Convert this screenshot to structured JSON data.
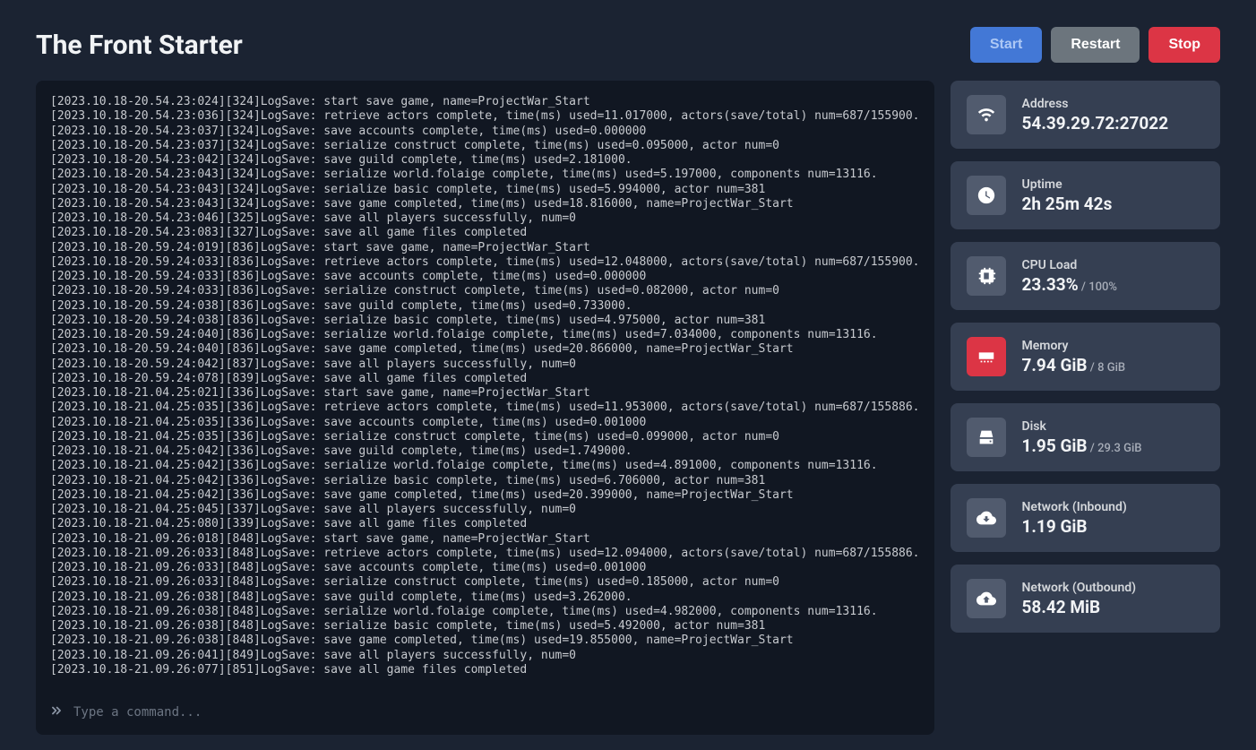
{
  "title": "The Front Starter",
  "buttons": {
    "start": "Start",
    "restart": "Restart",
    "stop": "Stop"
  },
  "console": {
    "placeholder": "Type a command...",
    "lines": [
      "[2023.10.18-20.54.23:024][324]LogSave: start save game, name=ProjectWar_Start",
      "[2023.10.18-20.54.23:036][324]LogSave: retrieve actors complete, time(ms) used=11.017000, actors(save/total) num=687/155900.",
      "[2023.10.18-20.54.23:037][324]LogSave: save accounts complete, time(ms) used=0.000000",
      "[2023.10.18-20.54.23:037][324]LogSave: serialize construct complete, time(ms) used=0.095000, actor num=0",
      "[2023.10.18-20.54.23:042][324]LogSave: save guild complete, time(ms) used=2.181000.",
      "[2023.10.18-20.54.23:043][324]LogSave: serialize world.folaige complete, time(ms) used=5.197000, components num=13116.",
      "[2023.10.18-20.54.23:043][324]LogSave: serialize basic complete, time(ms) used=5.994000, actor num=381",
      "[2023.10.18-20.54.23:043][324]LogSave: save game completed, time(ms) used=18.816000, name=ProjectWar_Start",
      "[2023.10.18-20.54.23:046][325]LogSave: save all players successfully, num=0",
      "[2023.10.18-20.54.23:083][327]LogSave: save all game files completed",
      "[2023.10.18-20.59.24:019][836]LogSave: start save game, name=ProjectWar_Start",
      "[2023.10.18-20.59.24:033][836]LogSave: retrieve actors complete, time(ms) used=12.048000, actors(save/total) num=687/155900.",
      "[2023.10.18-20.59.24:033][836]LogSave: save accounts complete, time(ms) used=0.000000",
      "[2023.10.18-20.59.24:033][836]LogSave: serialize construct complete, time(ms) used=0.082000, actor num=0",
      "[2023.10.18-20.59.24:038][836]LogSave: save guild complete, time(ms) used=0.733000.",
      "[2023.10.18-20.59.24:038][836]LogSave: serialize basic complete, time(ms) used=4.975000, actor num=381",
      "[2023.10.18-20.59.24:040][836]LogSave: serialize world.folaige complete, time(ms) used=7.034000, components num=13116.",
      "[2023.10.18-20.59.24:040][836]LogSave: save game completed, time(ms) used=20.866000, name=ProjectWar_Start",
      "[2023.10.18-20.59.24:042][837]LogSave: save all players successfully, num=0",
      "[2023.10.18-20.59.24:078][839]LogSave: save all game files completed",
      "[2023.10.18-21.04.25:021][336]LogSave: start save game, name=ProjectWar_Start",
      "[2023.10.18-21.04.25:035][336]LogSave: retrieve actors complete, time(ms) used=11.953000, actors(save/total) num=687/155886.",
      "[2023.10.18-21.04.25:035][336]LogSave: save accounts complete, time(ms) used=0.001000",
      "[2023.10.18-21.04.25:035][336]LogSave: serialize construct complete, time(ms) used=0.099000, actor num=0",
      "[2023.10.18-21.04.25:042][336]LogSave: save guild complete, time(ms) used=1.749000.",
      "[2023.10.18-21.04.25:042][336]LogSave: serialize world.folaige complete, time(ms) used=4.891000, components num=13116.",
      "[2023.10.18-21.04.25:042][336]LogSave: serialize basic complete, time(ms) used=6.706000, actor num=381",
      "[2023.10.18-21.04.25:042][336]LogSave: save game completed, time(ms) used=20.399000, name=ProjectWar_Start",
      "[2023.10.18-21.04.25:045][337]LogSave: save all players successfully, num=0",
      "[2023.10.18-21.04.25:080][339]LogSave: save all game files completed",
      "[2023.10.18-21.09.26:018][848]LogSave: start save game, name=ProjectWar_Start",
      "[2023.10.18-21.09.26:033][848]LogSave: retrieve actors complete, time(ms) used=12.094000, actors(save/total) num=687/155886.",
      "[2023.10.18-21.09.26:033][848]LogSave: save accounts complete, time(ms) used=0.001000",
      "[2023.10.18-21.09.26:033][848]LogSave: serialize construct complete, time(ms) used=0.185000, actor num=0",
      "[2023.10.18-21.09.26:038][848]LogSave: save guild complete, time(ms) used=3.262000.",
      "[2023.10.18-21.09.26:038][848]LogSave: serialize world.folaige complete, time(ms) used=4.982000, components num=13116.",
      "[2023.10.18-21.09.26:038][848]LogSave: serialize basic complete, time(ms) used=5.492000, actor num=381",
      "[2023.10.18-21.09.26:038][848]LogSave: save game completed, time(ms) used=19.855000, name=ProjectWar_Start",
      "[2023.10.18-21.09.26:041][849]LogSave: save all players successfully, num=0",
      "[2023.10.18-21.09.26:077][851]LogSave: save all game files completed"
    ]
  },
  "stats": {
    "address": {
      "label": "Address",
      "value": "54.39.29.72:27022"
    },
    "uptime": {
      "label": "Uptime",
      "value": "2h 25m 42s"
    },
    "cpu": {
      "label": "CPU Load",
      "value": "23.33%",
      "sub": " / 100%"
    },
    "memory": {
      "label": "Memory",
      "value": "7.94 GiB",
      "sub": " / 8 GiB"
    },
    "disk": {
      "label": "Disk",
      "value": "1.95 GiB",
      "sub": " / 29.3 GiB"
    },
    "net_in": {
      "label": "Network (Inbound)",
      "value": "1.19 GiB"
    },
    "net_out": {
      "label": "Network (Outbound)",
      "value": "58.42 MiB"
    }
  }
}
